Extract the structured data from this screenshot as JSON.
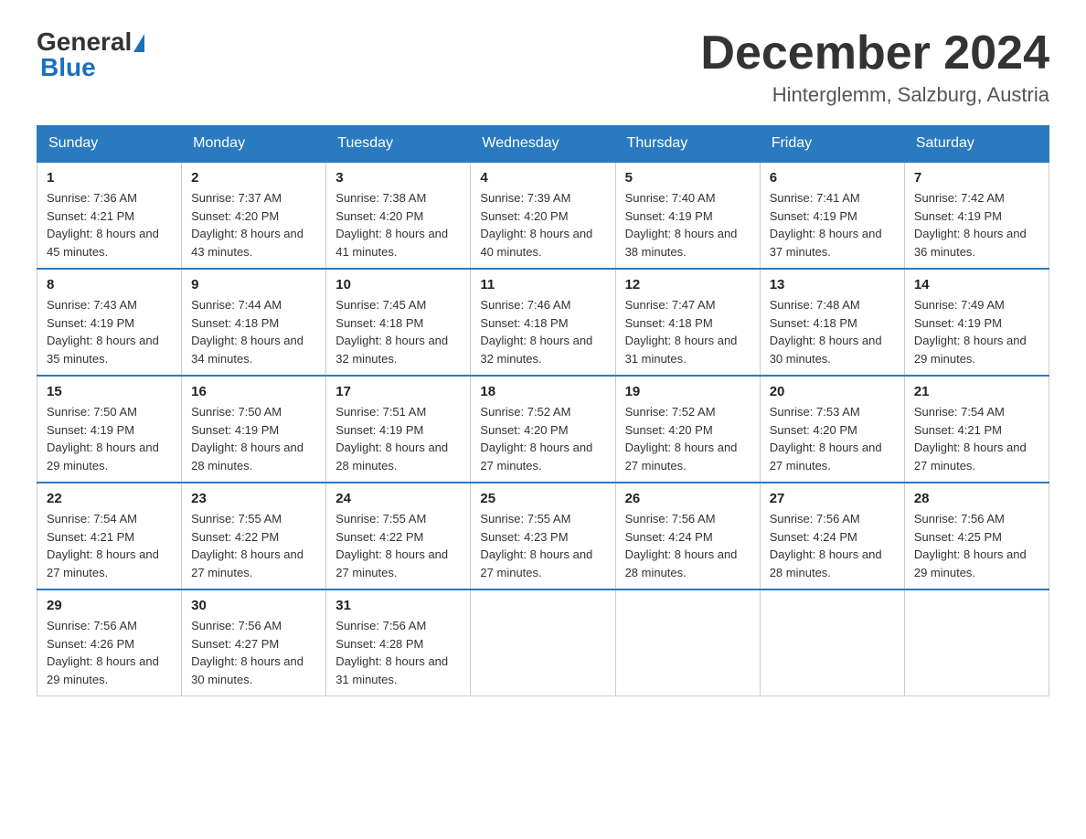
{
  "header": {
    "logo_general": "General",
    "logo_blue": "Blue",
    "month_year": "December 2024",
    "location": "Hinterglemm, Salzburg, Austria"
  },
  "days_of_week": [
    "Sunday",
    "Monday",
    "Tuesday",
    "Wednesday",
    "Thursday",
    "Friday",
    "Saturday"
  ],
  "weeks": [
    [
      {
        "day": "1",
        "sunrise": "7:36 AM",
        "sunset": "4:21 PM",
        "daylight": "8 hours and 45 minutes."
      },
      {
        "day": "2",
        "sunrise": "7:37 AM",
        "sunset": "4:20 PM",
        "daylight": "8 hours and 43 minutes."
      },
      {
        "day": "3",
        "sunrise": "7:38 AM",
        "sunset": "4:20 PM",
        "daylight": "8 hours and 41 minutes."
      },
      {
        "day": "4",
        "sunrise": "7:39 AM",
        "sunset": "4:20 PM",
        "daylight": "8 hours and 40 minutes."
      },
      {
        "day": "5",
        "sunrise": "7:40 AM",
        "sunset": "4:19 PM",
        "daylight": "8 hours and 38 minutes."
      },
      {
        "day": "6",
        "sunrise": "7:41 AM",
        "sunset": "4:19 PM",
        "daylight": "8 hours and 37 minutes."
      },
      {
        "day": "7",
        "sunrise": "7:42 AM",
        "sunset": "4:19 PM",
        "daylight": "8 hours and 36 minutes."
      }
    ],
    [
      {
        "day": "8",
        "sunrise": "7:43 AM",
        "sunset": "4:19 PM",
        "daylight": "8 hours and 35 minutes."
      },
      {
        "day": "9",
        "sunrise": "7:44 AM",
        "sunset": "4:18 PM",
        "daylight": "8 hours and 34 minutes."
      },
      {
        "day": "10",
        "sunrise": "7:45 AM",
        "sunset": "4:18 PM",
        "daylight": "8 hours and 32 minutes."
      },
      {
        "day": "11",
        "sunrise": "7:46 AM",
        "sunset": "4:18 PM",
        "daylight": "8 hours and 32 minutes."
      },
      {
        "day": "12",
        "sunrise": "7:47 AM",
        "sunset": "4:18 PM",
        "daylight": "8 hours and 31 minutes."
      },
      {
        "day": "13",
        "sunrise": "7:48 AM",
        "sunset": "4:18 PM",
        "daylight": "8 hours and 30 minutes."
      },
      {
        "day": "14",
        "sunrise": "7:49 AM",
        "sunset": "4:19 PM",
        "daylight": "8 hours and 29 minutes."
      }
    ],
    [
      {
        "day": "15",
        "sunrise": "7:50 AM",
        "sunset": "4:19 PM",
        "daylight": "8 hours and 29 minutes."
      },
      {
        "day": "16",
        "sunrise": "7:50 AM",
        "sunset": "4:19 PM",
        "daylight": "8 hours and 28 minutes."
      },
      {
        "day": "17",
        "sunrise": "7:51 AM",
        "sunset": "4:19 PM",
        "daylight": "8 hours and 28 minutes."
      },
      {
        "day": "18",
        "sunrise": "7:52 AM",
        "sunset": "4:20 PM",
        "daylight": "8 hours and 27 minutes."
      },
      {
        "day": "19",
        "sunrise": "7:52 AM",
        "sunset": "4:20 PM",
        "daylight": "8 hours and 27 minutes."
      },
      {
        "day": "20",
        "sunrise": "7:53 AM",
        "sunset": "4:20 PM",
        "daylight": "8 hours and 27 minutes."
      },
      {
        "day": "21",
        "sunrise": "7:54 AM",
        "sunset": "4:21 PM",
        "daylight": "8 hours and 27 minutes."
      }
    ],
    [
      {
        "day": "22",
        "sunrise": "7:54 AM",
        "sunset": "4:21 PM",
        "daylight": "8 hours and 27 minutes."
      },
      {
        "day": "23",
        "sunrise": "7:55 AM",
        "sunset": "4:22 PM",
        "daylight": "8 hours and 27 minutes."
      },
      {
        "day": "24",
        "sunrise": "7:55 AM",
        "sunset": "4:22 PM",
        "daylight": "8 hours and 27 minutes."
      },
      {
        "day": "25",
        "sunrise": "7:55 AM",
        "sunset": "4:23 PM",
        "daylight": "8 hours and 27 minutes."
      },
      {
        "day": "26",
        "sunrise": "7:56 AM",
        "sunset": "4:24 PM",
        "daylight": "8 hours and 28 minutes."
      },
      {
        "day": "27",
        "sunrise": "7:56 AM",
        "sunset": "4:24 PM",
        "daylight": "8 hours and 28 minutes."
      },
      {
        "day": "28",
        "sunrise": "7:56 AM",
        "sunset": "4:25 PM",
        "daylight": "8 hours and 29 minutes."
      }
    ],
    [
      {
        "day": "29",
        "sunrise": "7:56 AM",
        "sunset": "4:26 PM",
        "daylight": "8 hours and 29 minutes."
      },
      {
        "day": "30",
        "sunrise": "7:56 AM",
        "sunset": "4:27 PM",
        "daylight": "8 hours and 30 minutes."
      },
      {
        "day": "31",
        "sunrise": "7:56 AM",
        "sunset": "4:28 PM",
        "daylight": "8 hours and 31 minutes."
      },
      null,
      null,
      null,
      null
    ]
  ],
  "labels": {
    "sunrise": "Sunrise:",
    "sunset": "Sunset:",
    "daylight": "Daylight:"
  }
}
